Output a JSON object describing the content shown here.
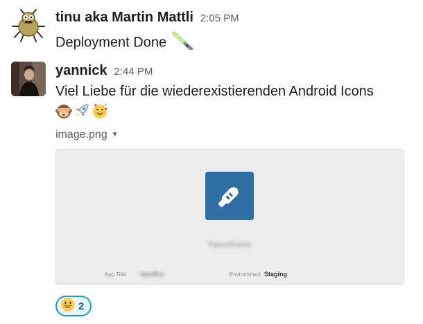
{
  "messages": [
    {
      "author": "tinu aka Martin Mattli",
      "time": "2:05 PM",
      "text": "Deployment Done",
      "text_emoji": "lightsaber-icon"
    },
    {
      "author": "yannick",
      "time": "2:44 PM",
      "text": "Viel Liebe für die wiederexistierenden Android Icons",
      "emojis": [
        "see-no-evil-monkey-icon",
        "rocket-icon",
        "smiling-face-with-hearts-icon"
      ],
      "attachment": {
        "file_name": "image.png",
        "preview": {
          "app_name": "Yasullivon",
          "app_title_label": "App Title",
          "app_title_value": "Yasullivo",
          "environment_label": "Environment",
          "environment_value": "Staging",
          "tile_color": "#2f6fa3"
        }
      },
      "reaction": {
        "emoji": "grinning-face-icon",
        "count": "2",
        "accent": "#1d9bd1"
      }
    }
  ]
}
